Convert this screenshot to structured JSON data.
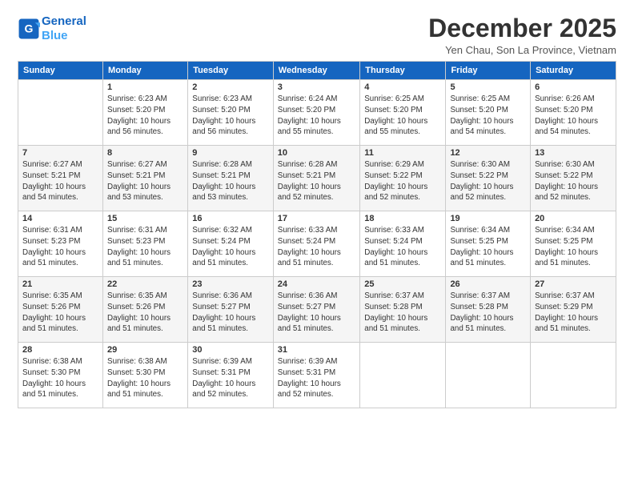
{
  "logo": {
    "line1": "General",
    "line2": "Blue"
  },
  "title": "December 2025",
  "location": "Yen Chau, Son La Province, Vietnam",
  "headers": [
    "Sunday",
    "Monday",
    "Tuesday",
    "Wednesday",
    "Thursday",
    "Friday",
    "Saturday"
  ],
  "weeks": [
    [
      {
        "day": "",
        "info": ""
      },
      {
        "day": "1",
        "info": "Sunrise: 6:23 AM\nSunset: 5:20 PM\nDaylight: 10 hours\nand 56 minutes."
      },
      {
        "day": "2",
        "info": "Sunrise: 6:23 AM\nSunset: 5:20 PM\nDaylight: 10 hours\nand 56 minutes."
      },
      {
        "day": "3",
        "info": "Sunrise: 6:24 AM\nSunset: 5:20 PM\nDaylight: 10 hours\nand 55 minutes."
      },
      {
        "day": "4",
        "info": "Sunrise: 6:25 AM\nSunset: 5:20 PM\nDaylight: 10 hours\nand 55 minutes."
      },
      {
        "day": "5",
        "info": "Sunrise: 6:25 AM\nSunset: 5:20 PM\nDaylight: 10 hours\nand 54 minutes."
      },
      {
        "day": "6",
        "info": "Sunrise: 6:26 AM\nSunset: 5:20 PM\nDaylight: 10 hours\nand 54 minutes."
      }
    ],
    [
      {
        "day": "7",
        "info": "Sunrise: 6:27 AM\nSunset: 5:21 PM\nDaylight: 10 hours\nand 54 minutes."
      },
      {
        "day": "8",
        "info": "Sunrise: 6:27 AM\nSunset: 5:21 PM\nDaylight: 10 hours\nand 53 minutes."
      },
      {
        "day": "9",
        "info": "Sunrise: 6:28 AM\nSunset: 5:21 PM\nDaylight: 10 hours\nand 53 minutes."
      },
      {
        "day": "10",
        "info": "Sunrise: 6:28 AM\nSunset: 5:21 PM\nDaylight: 10 hours\nand 52 minutes."
      },
      {
        "day": "11",
        "info": "Sunrise: 6:29 AM\nSunset: 5:22 PM\nDaylight: 10 hours\nand 52 minutes."
      },
      {
        "day": "12",
        "info": "Sunrise: 6:30 AM\nSunset: 5:22 PM\nDaylight: 10 hours\nand 52 minutes."
      },
      {
        "day": "13",
        "info": "Sunrise: 6:30 AM\nSunset: 5:22 PM\nDaylight: 10 hours\nand 52 minutes."
      }
    ],
    [
      {
        "day": "14",
        "info": "Sunrise: 6:31 AM\nSunset: 5:23 PM\nDaylight: 10 hours\nand 51 minutes."
      },
      {
        "day": "15",
        "info": "Sunrise: 6:31 AM\nSunset: 5:23 PM\nDaylight: 10 hours\nand 51 minutes."
      },
      {
        "day": "16",
        "info": "Sunrise: 6:32 AM\nSunset: 5:24 PM\nDaylight: 10 hours\nand 51 minutes."
      },
      {
        "day": "17",
        "info": "Sunrise: 6:33 AM\nSunset: 5:24 PM\nDaylight: 10 hours\nand 51 minutes."
      },
      {
        "day": "18",
        "info": "Sunrise: 6:33 AM\nSunset: 5:24 PM\nDaylight: 10 hours\nand 51 minutes."
      },
      {
        "day": "19",
        "info": "Sunrise: 6:34 AM\nSunset: 5:25 PM\nDaylight: 10 hours\nand 51 minutes."
      },
      {
        "day": "20",
        "info": "Sunrise: 6:34 AM\nSunset: 5:25 PM\nDaylight: 10 hours\nand 51 minutes."
      }
    ],
    [
      {
        "day": "21",
        "info": "Sunrise: 6:35 AM\nSunset: 5:26 PM\nDaylight: 10 hours\nand 51 minutes."
      },
      {
        "day": "22",
        "info": "Sunrise: 6:35 AM\nSunset: 5:26 PM\nDaylight: 10 hours\nand 51 minutes."
      },
      {
        "day": "23",
        "info": "Sunrise: 6:36 AM\nSunset: 5:27 PM\nDaylight: 10 hours\nand 51 minutes."
      },
      {
        "day": "24",
        "info": "Sunrise: 6:36 AM\nSunset: 5:27 PM\nDaylight: 10 hours\nand 51 minutes."
      },
      {
        "day": "25",
        "info": "Sunrise: 6:37 AM\nSunset: 5:28 PM\nDaylight: 10 hours\nand 51 minutes."
      },
      {
        "day": "26",
        "info": "Sunrise: 6:37 AM\nSunset: 5:28 PM\nDaylight: 10 hours\nand 51 minutes."
      },
      {
        "day": "27",
        "info": "Sunrise: 6:37 AM\nSunset: 5:29 PM\nDaylight: 10 hours\nand 51 minutes."
      }
    ],
    [
      {
        "day": "28",
        "info": "Sunrise: 6:38 AM\nSunset: 5:30 PM\nDaylight: 10 hours\nand 51 minutes."
      },
      {
        "day": "29",
        "info": "Sunrise: 6:38 AM\nSunset: 5:30 PM\nDaylight: 10 hours\nand 51 minutes."
      },
      {
        "day": "30",
        "info": "Sunrise: 6:39 AM\nSunset: 5:31 PM\nDaylight: 10 hours\nand 52 minutes."
      },
      {
        "day": "31",
        "info": "Sunrise: 6:39 AM\nSunset: 5:31 PM\nDaylight: 10 hours\nand 52 minutes."
      },
      {
        "day": "",
        "info": ""
      },
      {
        "day": "",
        "info": ""
      },
      {
        "day": "",
        "info": ""
      }
    ]
  ]
}
